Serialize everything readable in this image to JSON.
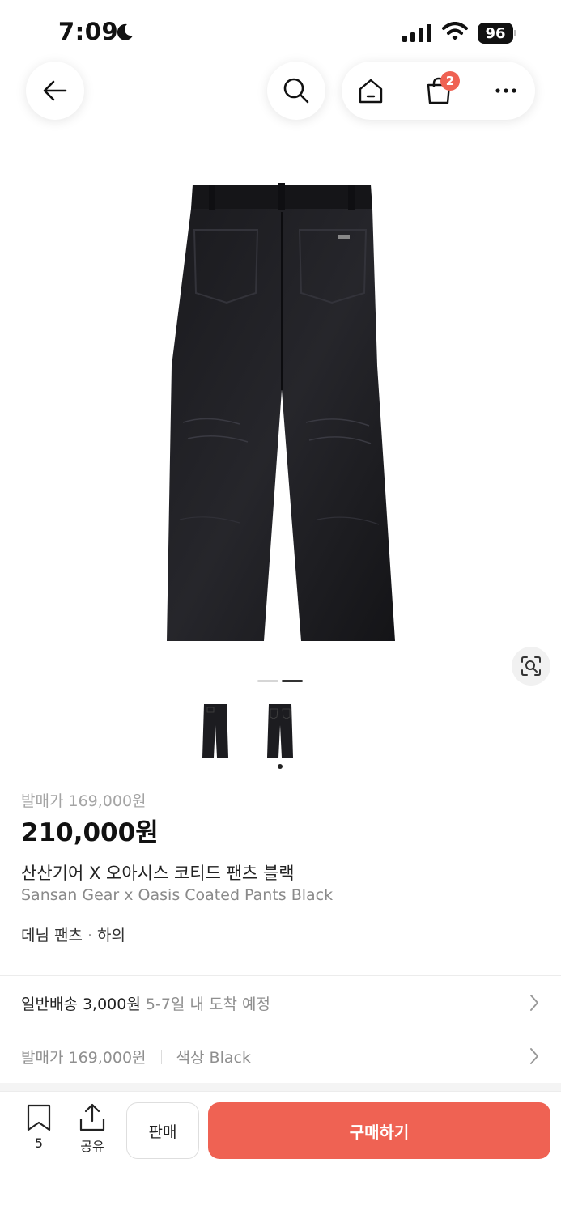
{
  "status_bar": {
    "time": "7:09",
    "battery": "96",
    "icons": [
      "moon-icon",
      "signal-icon",
      "wifi-icon",
      "battery-icon"
    ]
  },
  "nav": {
    "icons": [
      "back-arrow-icon",
      "search-icon",
      "home-icon",
      "shopping-bag-icon",
      "more-icon"
    ],
    "cart_badge": "2"
  },
  "gallery": {
    "page_count": 2,
    "active_page": 2,
    "thumbnails": [
      "thumbnail-1",
      "thumbnail-2"
    ],
    "lens_icon": "visual-search-icon"
  },
  "product": {
    "release_price": "발매가 169,000원",
    "price": "210,000원",
    "title_ko": "산산기어 X 오아시스 코티드 팬츠 블랙",
    "title_en": "Sansan Gear x Oasis Coated Pants Black",
    "category_1": "데님 팬츠",
    "category_sep": "·",
    "category_2": "하의"
  },
  "shipping": {
    "label": "일반배송 3,000원",
    "eta": "5-7일 내 도착 예정"
  },
  "summary": {
    "release_price": "발매가 169,000원",
    "color": "색상 Black"
  },
  "bottom_bar": {
    "bookmark_count": "5",
    "share_label": "공유",
    "sell_label": "판매",
    "buy_label": "구매하기"
  },
  "colors": {
    "accent": "#ef6253",
    "muted_text": "#8f8f8f"
  }
}
